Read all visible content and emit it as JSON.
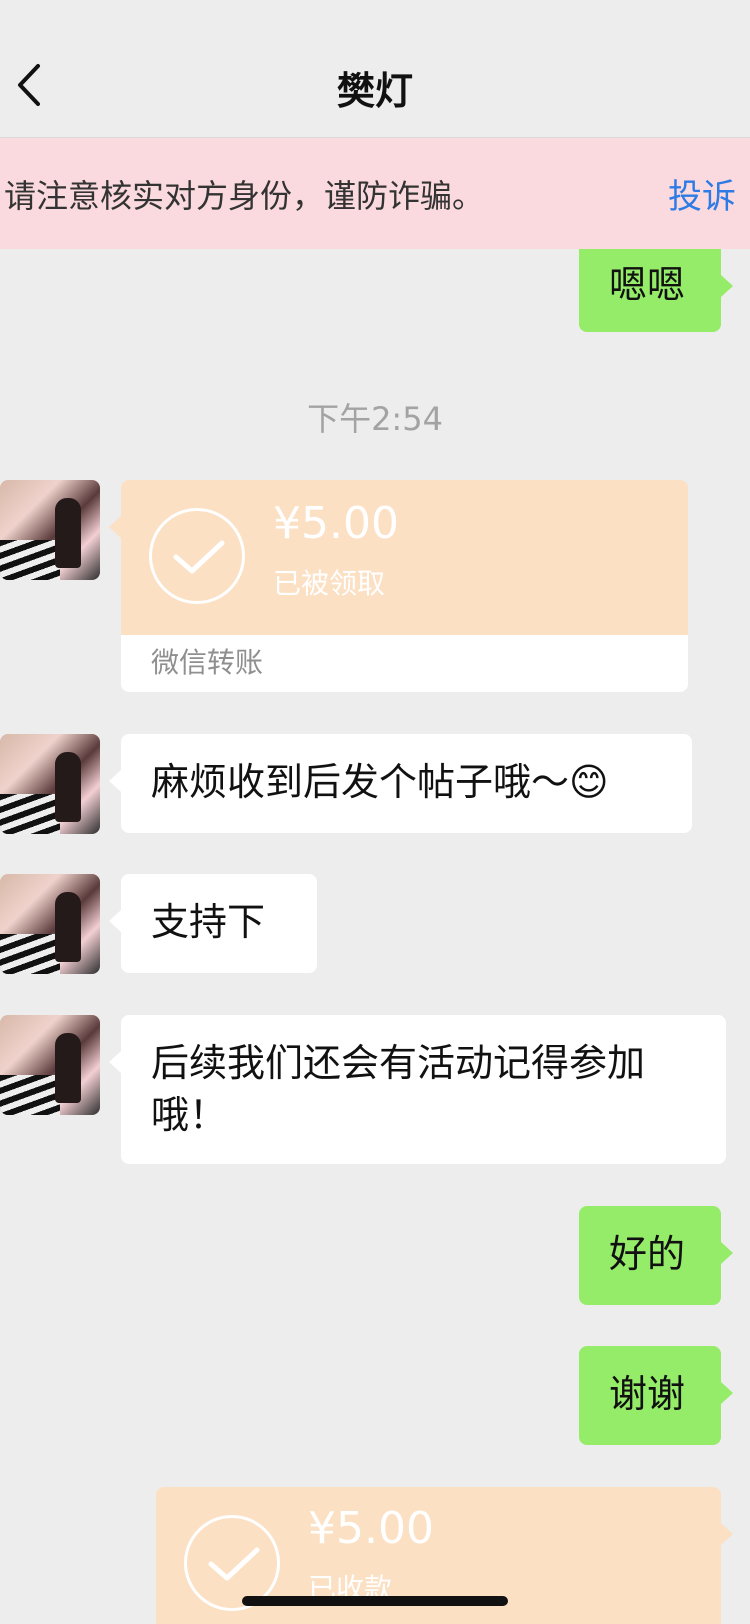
{
  "header": {
    "title": "樊灯",
    "back_icon": "chevron-left-icon"
  },
  "warning": {
    "text": "请注意核实对方身份，谨防诈骗。",
    "link": "投诉"
  },
  "messages": {
    "m1": {
      "text": "嗯嗯"
    },
    "time1": "下午2:54",
    "transfer_in": {
      "amount": "¥5.00",
      "status": "已被领取",
      "footer": "微信转账"
    },
    "m2": {
      "text": "麻烦收到后发个帖子哦～😊"
    },
    "m3": {
      "text": "支持下"
    },
    "m4": {
      "text": "后续我们还会有活动记得参加哦！"
    },
    "m5": {
      "text": "好的"
    },
    "m6": {
      "text": "谢谢"
    },
    "transfer_out": {
      "amount": "¥5.00",
      "status": "已收款"
    }
  },
  "colors": {
    "background": "#EDEDED",
    "warning_bg": "#FADADE",
    "link": "#2F7BE5",
    "green_bubble": "#95EC69",
    "transfer_bg": "#FCE0C4"
  }
}
